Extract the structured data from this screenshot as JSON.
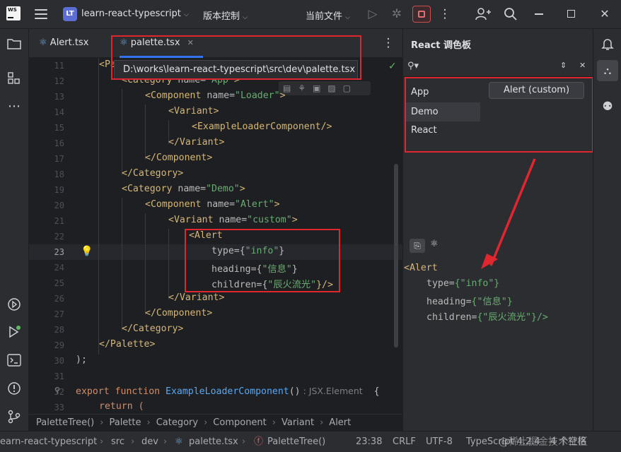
{
  "titlebar": {
    "logo": "WS",
    "project_badge": "LT",
    "project": "learn-react-typescript",
    "vcs": "版本控制",
    "run_config": "当前文件"
  },
  "tabs": [
    {
      "label": "Alert.tsx"
    },
    {
      "label": "palette.tsx"
    }
  ],
  "tooltip": "D:\\works\\learn-react-typescript\\src\\dev\\palette.tsx",
  "editor": {
    "lines": [
      "11",
      "12",
      "13",
      "14",
      "15",
      "16",
      "17",
      "18",
      "19",
      "20",
      "21",
      "22",
      "23",
      "24",
      "25",
      "26",
      "27",
      "28",
      "29",
      "30",
      "31",
      "32",
      "33"
    ]
  },
  "code": {
    "l11": "<Pa",
    "l12_t": "<Category",
    "l12_a": " name=",
    "l12_s": "\"App\"",
    "l12_e": ">",
    "l13_t": "<Component",
    "l13_a": " name=",
    "l13_s": "\"Loader\"",
    "l13_e": ">",
    "l14": "<Variant>",
    "l15": "<ExampleLoaderComponent/>",
    "l16": "</Variant>",
    "l17": "</Component>",
    "l18": "</Category>",
    "l19_t": "<Category",
    "l19_a": " name=",
    "l19_s": "\"Demo\"",
    "l19_e": ">",
    "l20_t": "<Component",
    "l20_a": " name=",
    "l20_s": "\"Alert\"",
    "l20_e": ">",
    "l21_t": "<Variant",
    "l21_a": " name=",
    "l21_s": "\"custom\"",
    "l21_e": ">",
    "l22": "<Alert",
    "l23_a": "type=",
    "l23_b": "{",
    "l23_s": "\"info\"",
    "l23_e": "}",
    "l24_a": "heading=",
    "l24_b": "{",
    "l24_s": "\"信息\"",
    "l24_e": "}",
    "l25_a": "children=",
    "l25_b": "{",
    "l25_s": "\"辰火流光\"",
    "l25_e": "}/>",
    "l26": "</Variant>",
    "l27": "</Component>",
    "l28": "</Category>",
    "l29": "</Palette>",
    "l30": ");",
    "l32_k": "export function ",
    "l32_f": "ExampleLoaderComponent",
    "l32_p": "()",
    "l32_h": " : JSX.Element",
    "l32_e": "  {",
    "l33": "return ("
  },
  "panel": {
    "title": "React 调色板",
    "categories": [
      "App",
      "Demo",
      "React"
    ],
    "component_button": "Alert (custom)",
    "preview": {
      "p1": "<Alert",
      "p2_a": "type=",
      "p2_s": "{\"info\"}",
      "p3_a": "heading=",
      "p3_s": "{\"信息\"}",
      "p4_a": "children=",
      "p4_s": "{\"辰火流光\"}/>"
    }
  },
  "breadcrumb": [
    "PaletteTree()",
    "Palette",
    "Category",
    "Component",
    "Variant",
    "Alert"
  ],
  "status": {
    "path": [
      "earn-react-typescript",
      "src",
      "dev",
      "palette.tsx",
      "PaletteTree()"
    ],
    "pos": "23:38",
    "eol": "CRLF",
    "enc": "UTF-8",
    "lang": "TypeScript 4.2.4",
    "indent": "4 个空格",
    "watermark": "@稀土掘金技术社区"
  },
  "colors": {
    "accent": "#3574f0",
    "error_outline": "#e0262f",
    "tag": "#d5b778",
    "string": "#6aab73"
  }
}
